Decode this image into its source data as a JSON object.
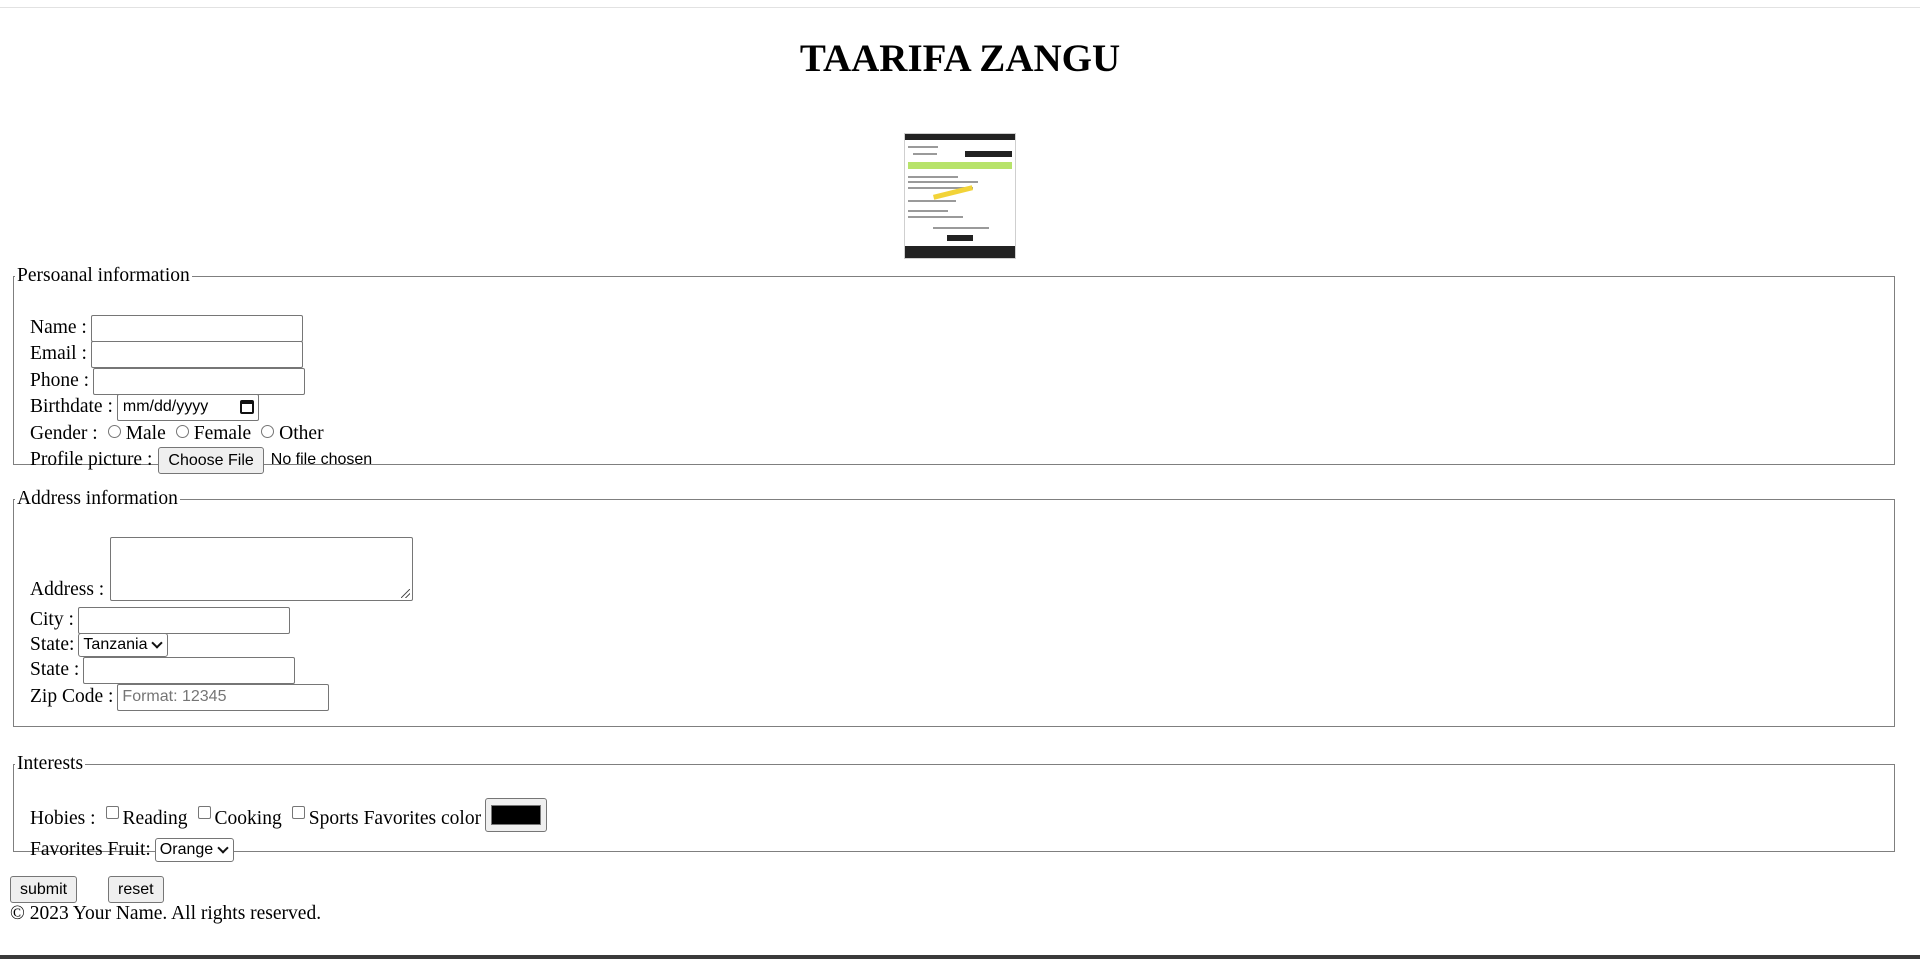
{
  "page": {
    "title": "TAARIFA ZANGU"
  },
  "personal": {
    "legend": "Persoanal information",
    "name_label": "Name :",
    "email_label": "Email :",
    "phone_label": "Phone :",
    "birthdate_label": "Birthdate :",
    "birthdate_placeholder": "mm/dd/yyyy",
    "gender_label": "Gender :",
    "gender_options": [
      "Male",
      "Female",
      "Other"
    ],
    "profile_label": "Profile picture :",
    "file_button": "Choose File",
    "file_status": "No file chosen"
  },
  "address": {
    "legend": "Address information",
    "address_label": "Address :",
    "city_label": "City :",
    "state_select_label": "State:",
    "state_selected": "Tanzania",
    "state_text_label": "State :",
    "zip_label": "Zip Code :",
    "zip_placeholder": "Format: 12345"
  },
  "interests": {
    "legend": "Interests",
    "hobbies_label": "Hobies :",
    "hobbies": [
      "Reading",
      "Cooking",
      "Sports"
    ],
    "color_label": "Favorites color",
    "color_value": "#000000",
    "fruit_label": "Favorites Fruit:",
    "fruit_selected": "Orange"
  },
  "actions": {
    "submit": "submit",
    "reset": "reset"
  },
  "footer": {
    "text": "© 2023 Your Name. All rights reserved."
  },
  "icons": {
    "calendar": "calendar-icon",
    "dropdown": "chevron-down-icon",
    "resize": "resize-grip-icon"
  }
}
